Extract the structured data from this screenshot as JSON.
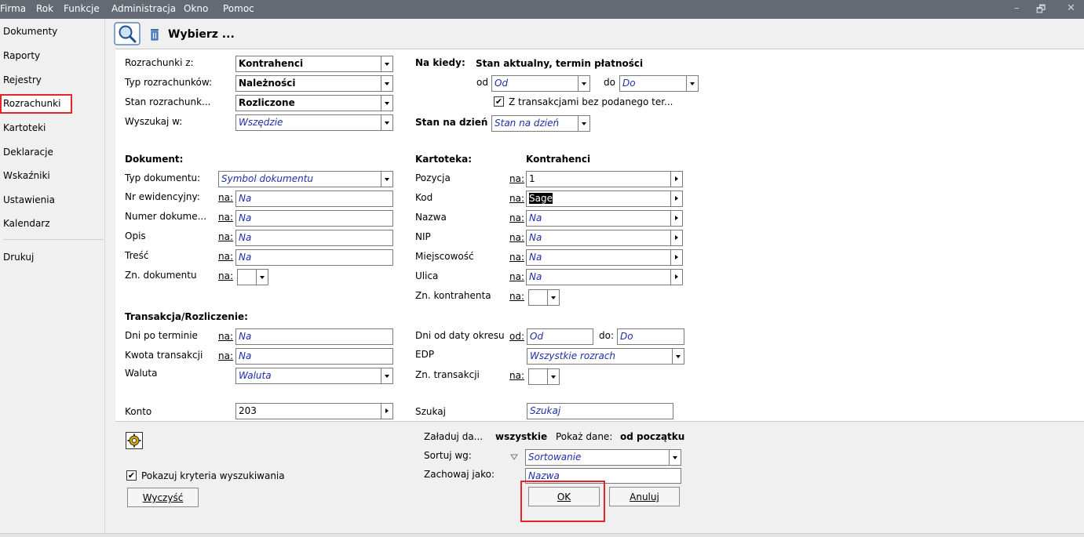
{
  "menu": {
    "items": [
      "Firma",
      "Rok",
      "Funkcje",
      "Administracja",
      "Okno",
      "Pomoc"
    ],
    "window_controls": [
      "–",
      "🗗",
      "✕"
    ]
  },
  "sidebar": {
    "items": [
      "Dokumenty",
      "Raporty",
      "Rejestry",
      "Rozrachunki",
      "Kartoteki",
      "Deklaracje",
      "Wskaźniki",
      "Ustawienia",
      "Kalendarz"
    ],
    "print": "Drukuj",
    "selected": "Rozrachunki"
  },
  "dialog": {
    "title": "Wybierz ..."
  },
  "na_label": "na:",
  "left": {
    "rozrachunki_z": {
      "label": "Rozrachunki z:",
      "value": "Kontrahenci"
    },
    "typ": {
      "label": "Typ rozrachunków:",
      "value": "Należności"
    },
    "stan": {
      "label": "Stan rozrachunk...",
      "value": "Rozliczone"
    },
    "wyszukaj": {
      "label": "Wyszukaj w:",
      "value": "Wszędzie"
    }
  },
  "na_kiedy": {
    "label": "Na kiedy:",
    "value": "Stan aktualny, termin płatności",
    "od_label": "od",
    "od_value": "Od",
    "do_label": "do",
    "do_value": "Do",
    "checkbox_label": "Z transakcjami bez podanego ter...",
    "checkbox_checked": "✔",
    "stan_na_dzien_label": "Stan na dzień",
    "stan_na_dzien_value": "Stan na dzień"
  },
  "dokument": {
    "header": "Dokument:",
    "typ_label": "Typ dokumentu:",
    "typ_value": "Symbol dokumentu",
    "nr_label": "Nr ewidencyjny:",
    "nr_value": "Na",
    "numer_label": "Numer dokume...",
    "numer_value": "Na",
    "opis_label": "Opis",
    "opis_value": "Na",
    "tresc_label": "Treść",
    "tresc_value": "Na",
    "zn_label": "Zn. dokumentu"
  },
  "kartoteka": {
    "header": "Kartoteka:",
    "header_value": "Kontrahenci",
    "pozycja_label": "Pozycja",
    "pozycja_value": "1",
    "kod_label": "Kod",
    "kod_value": "Sage",
    "nazwa_label": "Nazwa",
    "nazwa_value": "Na",
    "nip_label": "NIP",
    "nip_value": "Na",
    "miejscowosc_label": "Miejscowość",
    "miejscowosc_value": "Na",
    "ulica_label": "Ulica",
    "ulica_value": "Na",
    "zn_label": "Zn. kontrahenta"
  },
  "transakcja": {
    "header": "Transakcja/Rozliczenie:",
    "dni_label": "Dni po terminie",
    "dni_value": "Na",
    "kwota_label": "Kwota transakcji",
    "kwota_value": "Na",
    "waluta_label": "Waluta",
    "waluta_value": "Waluta"
  },
  "right_trans": {
    "dni_okresu_label": "Dni od daty okresu",
    "od_label": "od:",
    "od_value": "Od",
    "do_label": "do:",
    "do_value": "Do",
    "edp_label": "EDP",
    "edp_value": "Wszystkie rozrach",
    "zn_label": "Zn. transakcji"
  },
  "konto": {
    "label": "Konto",
    "value": "203"
  },
  "szukaj": {
    "label": "Szukaj",
    "value": "Szukaj"
  },
  "bottom": {
    "zaladuj_label": "Załaduj da...",
    "zaladuj_value": "wszystkie",
    "pokaz_label": "Pokaż dane:",
    "pokaz_value": "od początku",
    "sortuj_label": "Sortuj wg:",
    "sortuj_value": "Sortowanie",
    "zachowaj_label": "Zachowaj jako:",
    "zachowaj_value": "Nazwa",
    "pokazuj_label": "Pokazuj kryteria wyszukiwania",
    "pokazuj_checked": "✔",
    "wyczysc": "Wyczyść",
    "ok": "OK",
    "anuluj": "Anuluj"
  }
}
